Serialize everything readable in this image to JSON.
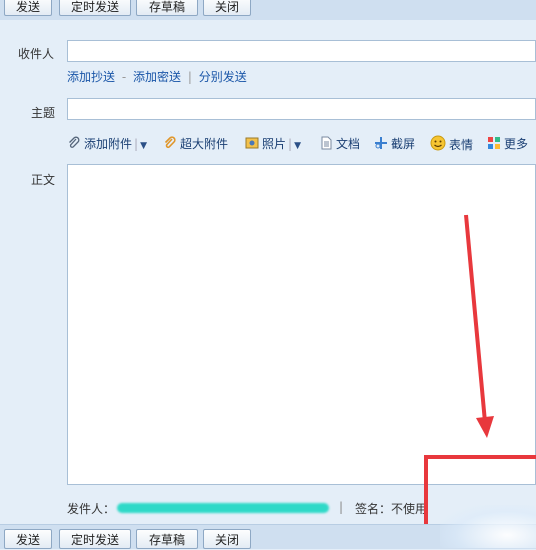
{
  "toolbar": {
    "send": "发送",
    "scheduled_send": "定时发送",
    "save_draft": "存草稿",
    "close": "关闭"
  },
  "recipients": {
    "label": "收件人",
    "value": "",
    "add_cc": "添加抄送",
    "dash": "-",
    "add_bcc": "添加密送",
    "separator": "|",
    "separate_send": "分别发送"
  },
  "subject": {
    "label": "主题",
    "value": ""
  },
  "attach_toolbar": {
    "add_attachment": "添加附件",
    "large_attachment": "超大附件",
    "photo": "照片",
    "document": "文档",
    "screenshot": "截屏",
    "emoticon": "表情",
    "more": "更多"
  },
  "body": {
    "label": "正文"
  },
  "footer": {
    "sender_label": "发件人：",
    "separator": "|",
    "signature_label": "签名：不使用"
  },
  "colors": {
    "annotation": "#e8383d",
    "link": "#1a56a8",
    "redaction": "#2fd9c8"
  }
}
